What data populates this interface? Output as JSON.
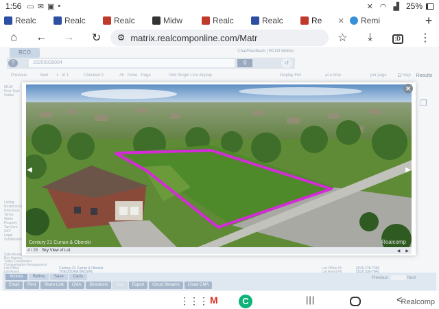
{
  "status_bar": {
    "time": "1:56",
    "battery": "25%"
  },
  "tabs": [
    {
      "label": "Realc",
      "favicon_color": "#2d4fa3",
      "active": false
    },
    {
      "label": "Realc",
      "favicon_color": "#2d4fa3",
      "active": false
    },
    {
      "label": "Realc",
      "favicon_color": "#c0392b",
      "active": false
    },
    {
      "label": "Midw",
      "favicon_color": "#333333",
      "active": false
    },
    {
      "label": "Realc",
      "favicon_color": "#c0392b",
      "active": false
    },
    {
      "label": "Realc",
      "favicon_color": "#2d4fa3",
      "active": false
    },
    {
      "label": "Re",
      "favicon_color": "#c0392b",
      "active": true
    },
    {
      "label": "Remi",
      "favicon_color": "#3a8fd9",
      "active": false
    }
  ],
  "toolbar": {
    "url": "matrix.realcomponline.com/Matr",
    "tab_count": ":D"
  },
  "page": {
    "logo_text": "RCO",
    "top_links": "Chat/Feedback | RCO3 Mobile",
    "search_value": "20250035004",
    "nav": {
      "previous": "Previous",
      "next": "Next",
      "page": "1",
      "of": "of 1",
      "checked": "Checked 0",
      "all_none_page": "All · None · Page",
      "grid": "Grid Single Line display",
      "display": "Display  Full",
      "at_a_time": "at a time",
      "per_page": "per page",
      "map": "Map",
      "results": "Results"
    },
    "left_labels": [
      "MLS#",
      "Prop Type",
      "Status",
      "Listing",
      "Restrictions",
      "Directions",
      "Terms",
      "Water",
      "Property",
      "Tax Sum",
      "SEV",
      "Legal",
      "Subdivision"
    ],
    "details": [
      {
        "label": "Sale Arrangement",
        "value": ""
      },
      {
        "label": "Buy Agency",
        "value": ""
      },
      {
        "label": "Trans Coordinator",
        "value": ""
      },
      {
        "label": "Compensation Arrangement",
        "value": ""
      },
      {
        "label": "List Office",
        "value": "Century 21 Curran & Oberski",
        "right_label": "List Office Ph",
        "right_value": "(313) 278-7200"
      },
      {
        "label": "List Agent",
        "value": "THEODORA BROWN",
        "right_label": "List Agent Ph",
        "right_value": "(313) 330-7641"
      }
    ],
    "action_tabs": [
      "Actions",
      "Refine",
      "Save",
      "Carts"
    ],
    "action_buttons": [
      {
        "label": "Email",
        "enabled": true
      },
      {
        "label": "Print",
        "enabled": true
      },
      {
        "label": "Share Link",
        "enabled": true
      },
      {
        "label": "CMA",
        "enabled": true
      },
      {
        "label": "Directions",
        "enabled": true
      },
      {
        "label": "Map",
        "enabled": false
      },
      {
        "label": "Export",
        "enabled": true
      },
      {
        "label": "Cloud Streams",
        "enabled": true
      },
      {
        "label": "Cloud CMA",
        "enabled": true
      }
    ],
    "pager": {
      "previous": "Previous",
      "next": "Next"
    }
  },
  "photo_modal": {
    "counter": "4 / 29",
    "caption": "Sky View of Lot",
    "watermark_left": "Century 21 Curran & Oberski",
    "watermark_right": "Realcomp",
    "lot_outline_color": "#d42bd8"
  },
  "system_nav": {
    "brand": "Realcomp"
  }
}
